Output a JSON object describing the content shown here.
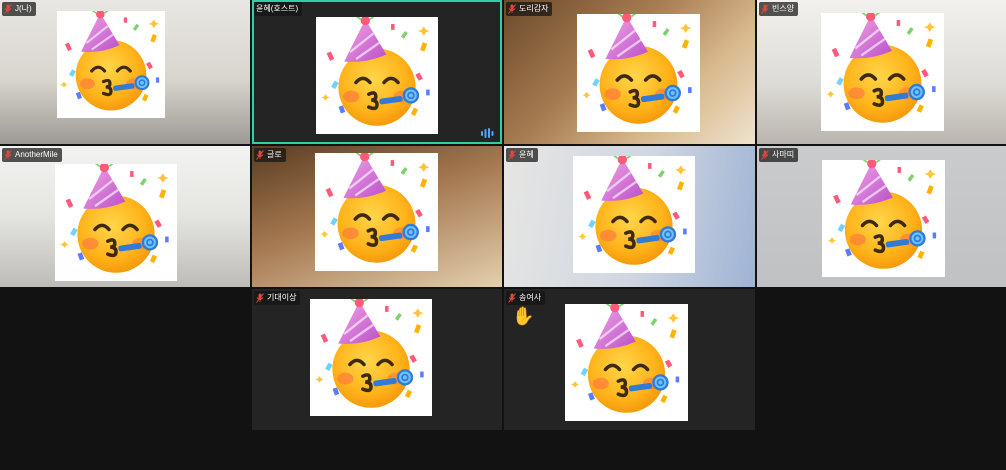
{
  "participants": [
    {
      "name": "J(나)"
    },
    {
      "name": "윤혜(호스트)"
    },
    {
      "name": "도리감자"
    },
    {
      "name": "빈스양"
    },
    {
      "name": "AnotherMile"
    },
    {
      "name": "글로"
    },
    {
      "name": "윤혜"
    },
    {
      "name": "사마띠"
    },
    {
      "name": "기대이상"
    },
    {
      "name": "송여사"
    }
  ],
  "hand_raised": "✋",
  "colors": {
    "background": "#121212",
    "active_speaker_border": "#2fd0a6",
    "muted_mic": "#e0483b"
  }
}
